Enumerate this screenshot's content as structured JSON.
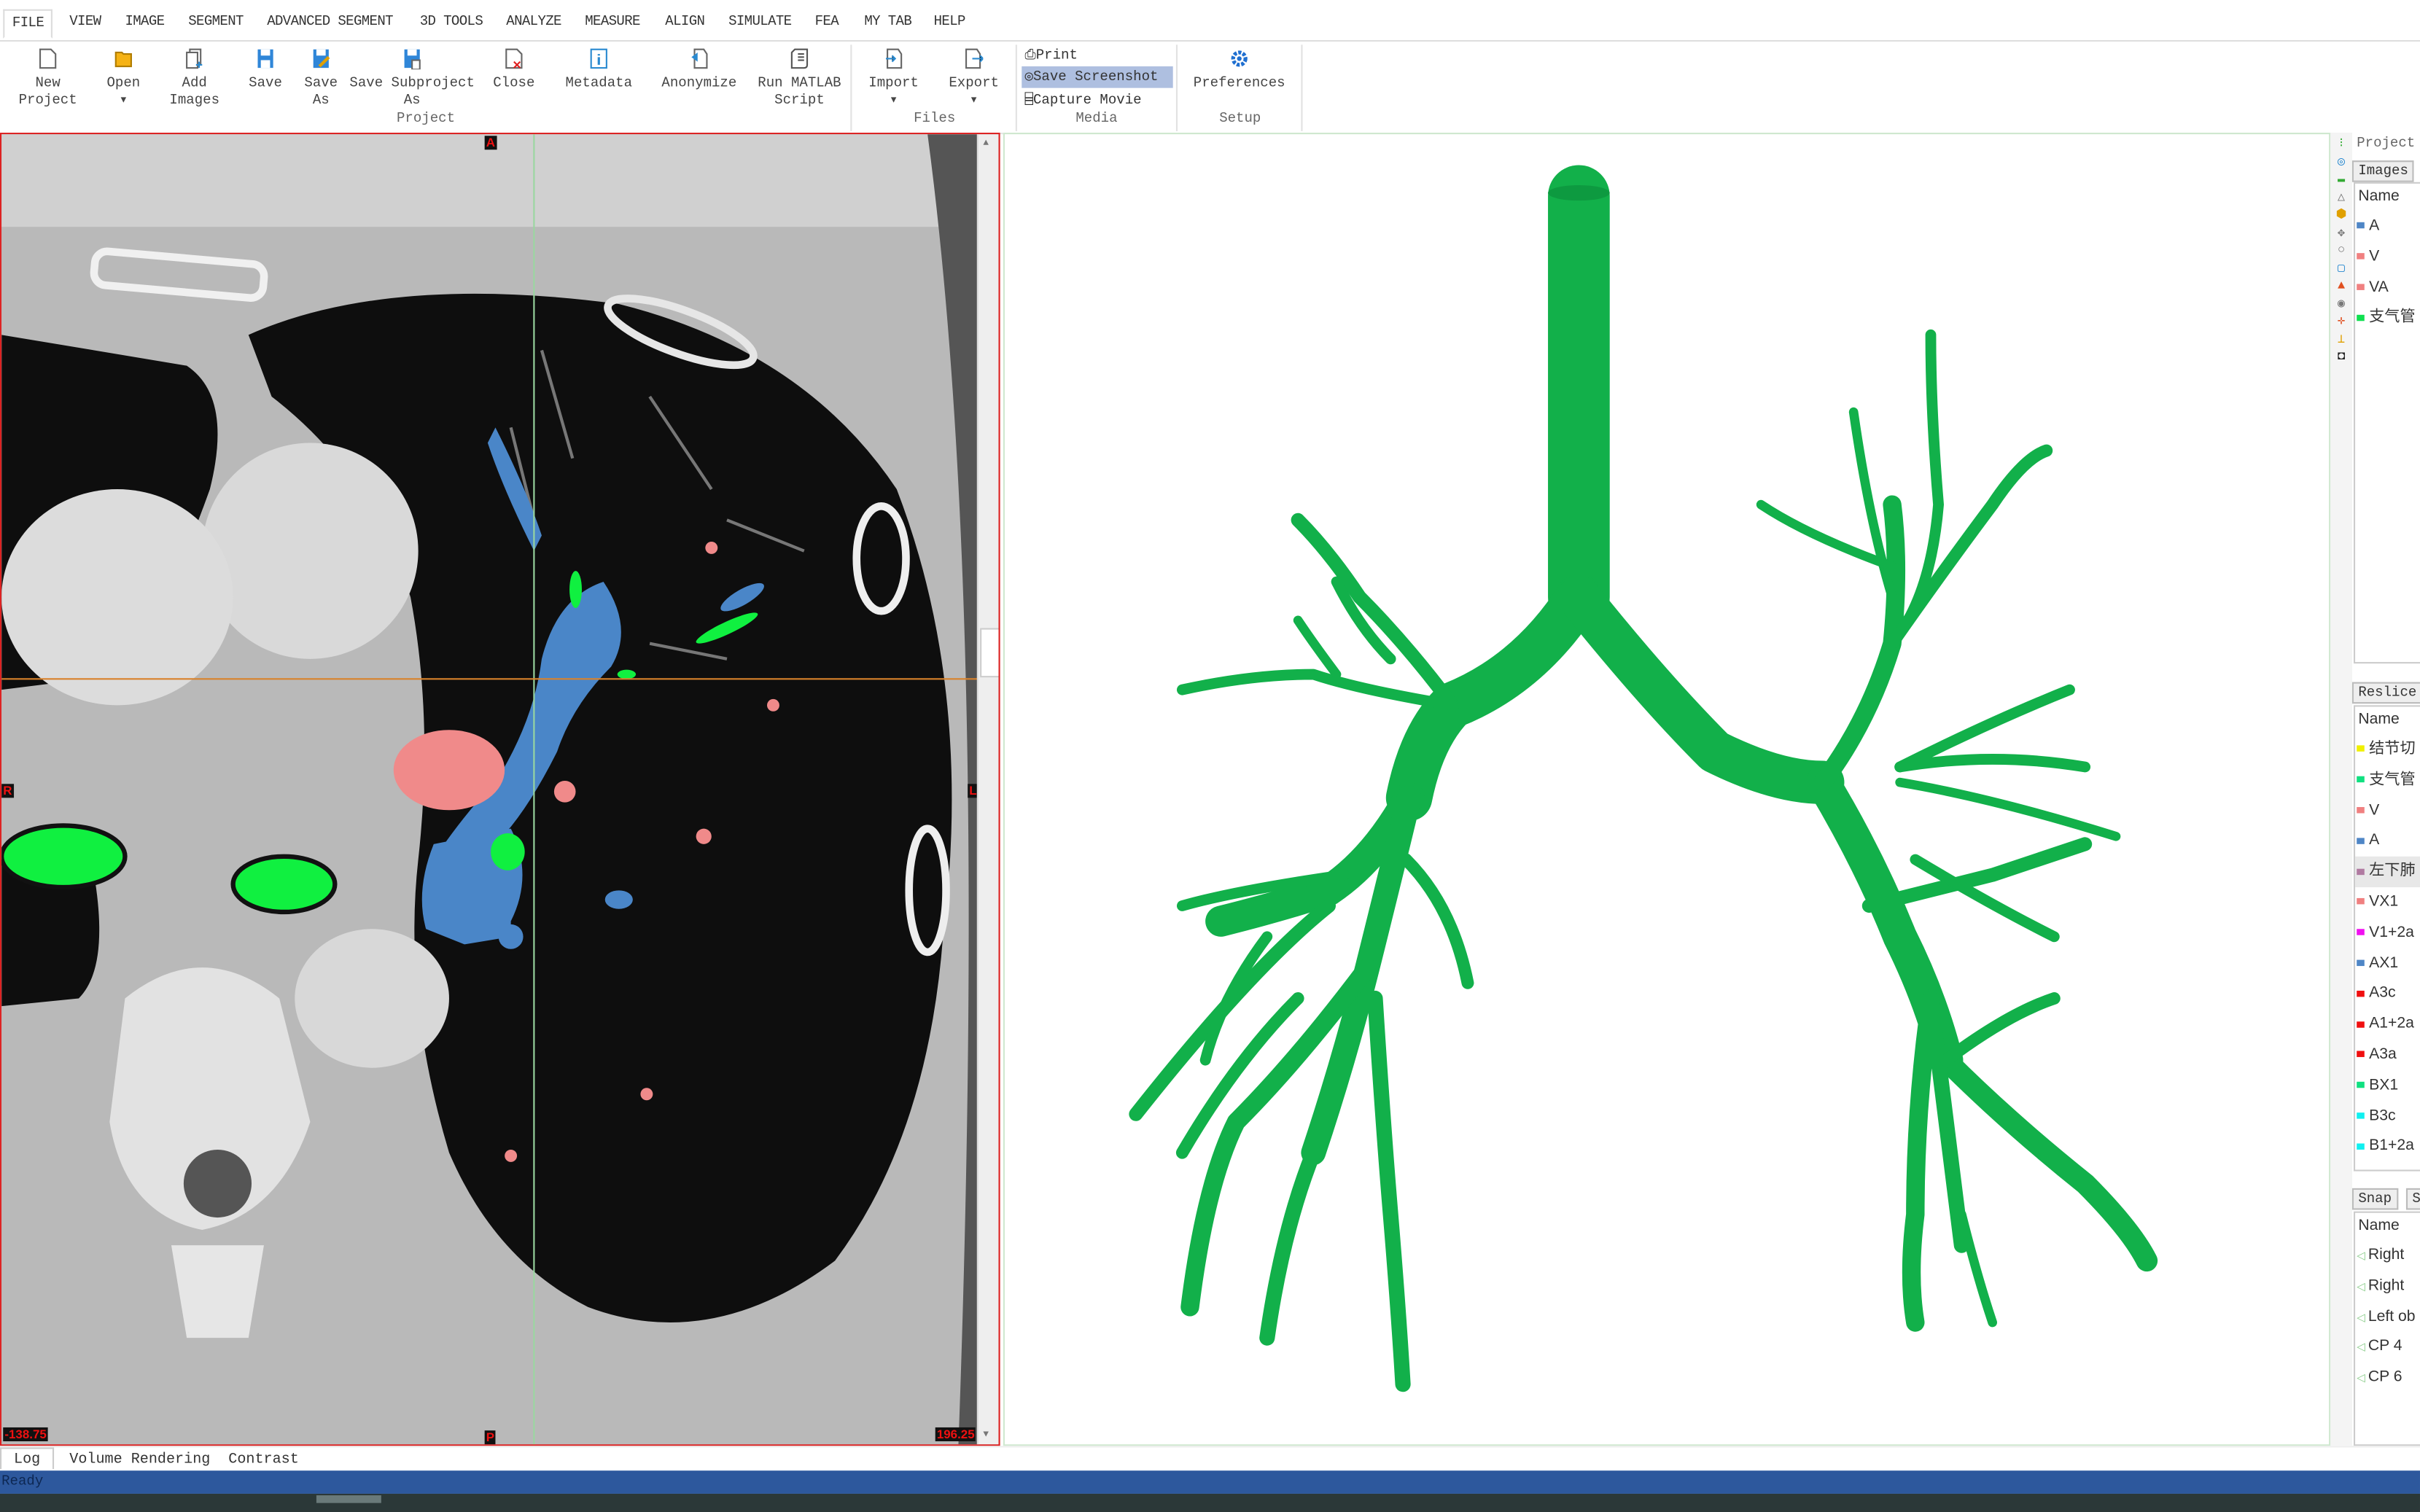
{
  "menu": {
    "tabs": [
      "FILE",
      "VIEW",
      "IMAGE",
      "SEGMENT",
      "ADVANCED SEGMENT",
      "3D TOOLS",
      "ANALYZE",
      "MEASURE",
      "ALIGN",
      "SIMULATE",
      "FEA",
      "MY TAB",
      "HELP"
    ],
    "active": "FILE"
  },
  "ribbon": {
    "project": {
      "new_project": [
        "New",
        "Project"
      ],
      "open": [
        "Open",
        "▾"
      ],
      "add_images": [
        "Add",
        "Images"
      ],
      "save": "Save",
      "save_as": [
        "Save",
        "As"
      ],
      "save_subproject_as": [
        "Save Subproject",
        "As"
      ],
      "close": "Close",
      "metadata": "Metadata",
      "anonymize": "Anonymize",
      "run_matlab": [
        "Run MATLAB",
        "Script"
      ],
      "group_label": "Project"
    },
    "files": {
      "import": [
        "Import",
        "▾"
      ],
      "export": [
        "Export",
        "▾"
      ],
      "group_label": "Files"
    },
    "media": {
      "print": "Print",
      "save_screenshot": "Save Screenshot",
      "capture_movie": "Capture Movie",
      "group_label": "Media"
    },
    "setup": {
      "preferences": "Preferences",
      "group_label": "Setup"
    }
  },
  "viewer2d": {
    "orientation": {
      "top": "A",
      "left": "R",
      "right": "L",
      "bottom": "P"
    },
    "range_min": "-138.75",
    "range_max": "196.25",
    "colors": {
      "artery": "#4a86c8",
      "vein": "#f08a8a",
      "bronchus": "#10f040",
      "crosshair_h": "#d9822b",
      "crosshair_v": "#9ad7a0"
    }
  },
  "viewer3d": {
    "model_color": "#12b04a"
  },
  "right_panel": {
    "project_label": "Project",
    "images_tab": "Images",
    "name_header": "Name",
    "images": [
      {
        "label": "A",
        "color": "#4f86c6"
      },
      {
        "label": "V",
        "color": "#f08080"
      },
      {
        "label": "VA",
        "color": "#f08080"
      },
      {
        "label": "支气管",
        "color": "#10e050"
      }
    ],
    "reslice_tab": "Reslice",
    "reslice": [
      {
        "label": "结节切",
        "color": "#f0f000"
      },
      {
        "label": "支气管",
        "color": "#10e080"
      },
      {
        "label": "V",
        "color": "#f08080"
      },
      {
        "label": "A",
        "color": "#4f86c6"
      },
      {
        "label": "左下肺",
        "color": "#b07aa1",
        "selected": true
      },
      {
        "label": "VX1",
        "color": "#f08080"
      },
      {
        "label": "V1+2a",
        "color": "#f010f0"
      },
      {
        "label": "AX1",
        "color": "#4f86c6"
      },
      {
        "label": "A3c",
        "color": "#f01010"
      },
      {
        "label": "A1+2a",
        "color": "#f01010"
      },
      {
        "label": "A3a",
        "color": "#f01010"
      },
      {
        "label": "BX1",
        "color": "#10e080"
      },
      {
        "label": "B3c",
        "color": "#10f0f0"
      },
      {
        "label": "B1+2a",
        "color": "#10f0f0"
      }
    ],
    "snap_tab": "Snap",
    "snap_tab2": "S",
    "snaps": [
      "Right",
      "Right",
      "Left ob",
      "CP 4",
      "CP 6"
    ]
  },
  "bottom_tabs": [
    "Log",
    "Volume Rendering",
    "Contrast"
  ],
  "status": "Ready"
}
